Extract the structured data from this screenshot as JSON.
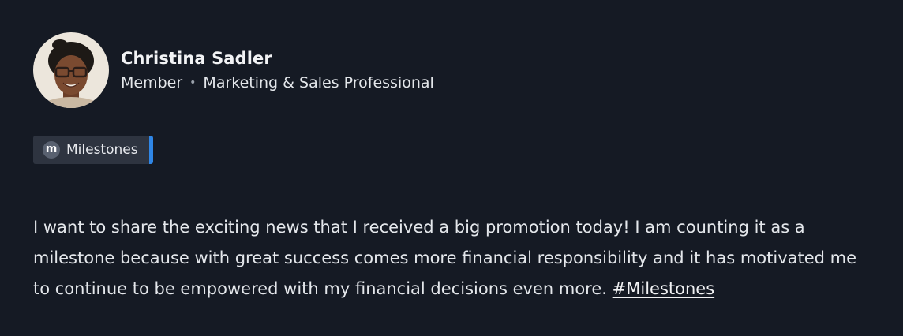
{
  "author": {
    "name": "Christina Sadler",
    "role": "Member",
    "title": "Marketing & Sales Professional",
    "separator": "•",
    "avatar_icon": "avatar-photo"
  },
  "tag": {
    "icon_letter": "m",
    "label": "Milestones",
    "accent_color": "#2f86e6"
  },
  "post": {
    "text": "I want to share the exciting news that I received a big promotion today! I am counting it as a milestone because with great success comes more financial responsibility and it has motivated me to continue to be empowered with my financial decisions even more.",
    "hashtag": "#Milestones"
  },
  "colors": {
    "background": "#151a24",
    "text": "#e4e7eb",
    "tag_background": "#2e3440"
  }
}
